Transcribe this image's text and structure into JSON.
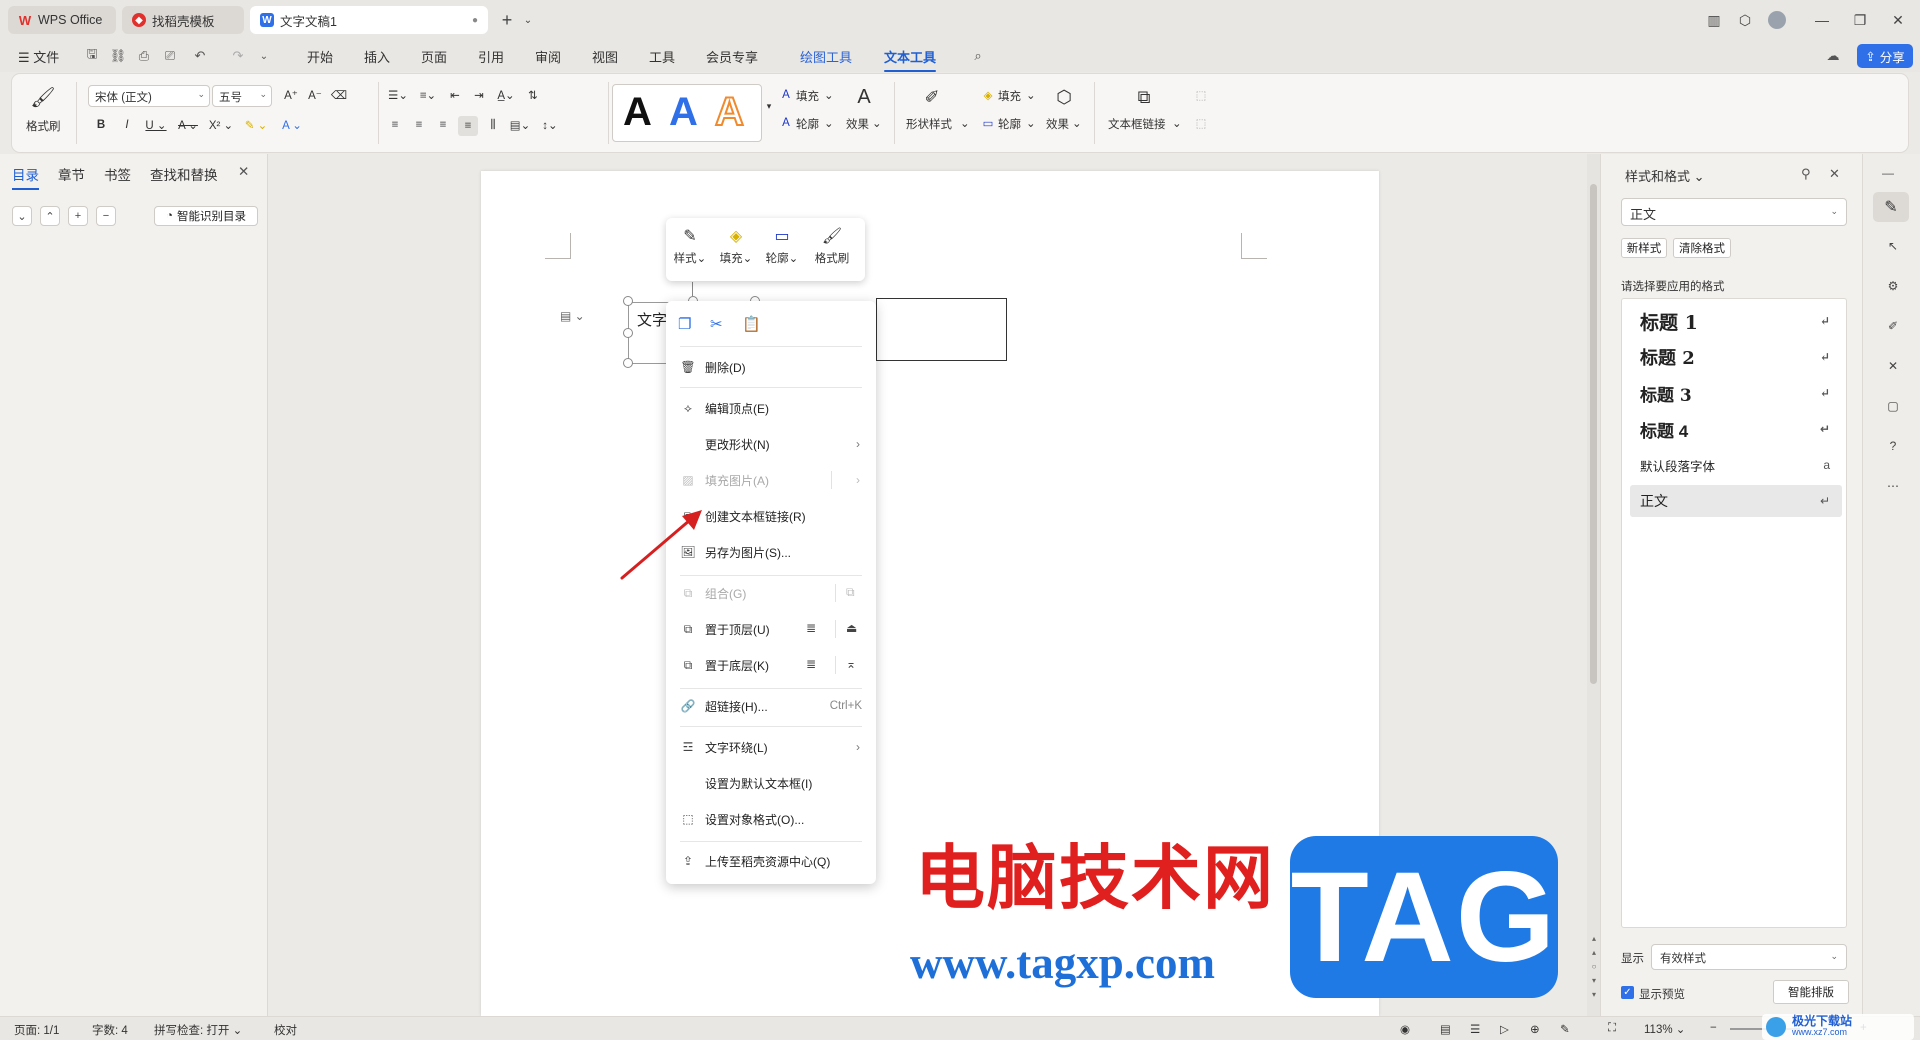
{
  "tabs": [
    {
      "label": "WPS Office",
      "icon": "wps-logo-icon"
    },
    {
      "label": "找稻壳模板",
      "icon": "docer-icon"
    },
    {
      "label": "文字文稿1",
      "icon": "writer-icon"
    }
  ],
  "menubar": {
    "file": "文件",
    "items": [
      "开始",
      "插入",
      "页面",
      "引用",
      "审阅",
      "视图",
      "工具",
      "会员专享"
    ],
    "context_tabs": [
      "绘图工具",
      "文本工具"
    ],
    "share": "分享"
  },
  "ribbon": {
    "format_painter": "格式刷",
    "font_name": "宋体 (正文)",
    "font_size": "五号",
    "fill": "填充",
    "outline": "轮廓",
    "effect": "效果",
    "shape_style": "形状样式",
    "fill2": "填充",
    "outline2": "轮廓",
    "effect2": "效果",
    "textbox_link": "文本框链接",
    "art_letters": [
      "A",
      "A",
      "A"
    ]
  },
  "leftpanel": {
    "tabs": [
      "目录",
      "章节",
      "书签",
      "查找和替换"
    ],
    "smart_toc": "智能识别目录"
  },
  "document": {
    "textbox_text": "文字"
  },
  "float_toolbar": {
    "items": [
      "样式",
      "填充",
      "轮廓",
      "格式刷"
    ]
  },
  "context_menu": {
    "delete": "删除(D)",
    "edit_points": "编辑顶点(E)",
    "change_shape": "更改形状(N)",
    "fill_picture": "填充图片(A)",
    "create_textbox_link": "创建文本框链接(R)",
    "save_as_picture": "另存为图片(S)...",
    "group": "组合(G)",
    "bring_to_front": "置于顶层(U)",
    "send_to_back": "置于底层(K)",
    "hyperlink": "超链接(H)...",
    "hyperlink_shortcut": "Ctrl+K",
    "text_wrap": "文字环绕(L)",
    "set_default_textbox": "设置为默认文本框(I)",
    "format_object": "设置对象格式(O)...",
    "upload": "上传至稻壳资源中心(Q)"
  },
  "rightpanel": {
    "title": "样式和格式",
    "current_style": "正文",
    "new_style": "新样式",
    "clear_format": "清除格式",
    "prompt": "请选择要应用的格式",
    "styles": [
      "标题 1",
      "标题 2",
      "标题 3",
      "标题 4",
      "默认段落字体",
      "正文"
    ],
    "display_label": "显示",
    "display_value": "有效样式",
    "show_preview": "显示预览",
    "smart_layout": "智能排版"
  },
  "statusbar": {
    "page": "页面: 1/1",
    "words": "字数: 4",
    "spell": "拼写检查: 打开",
    "proof": "校对",
    "zoom": "113%"
  },
  "watermark": {
    "cn": "电脑技术网",
    "url": "www.tagxp.com",
    "tag": "TAG",
    "corner": "极光下载站",
    "corner_url": "www.xz7.com"
  },
  "colors": {
    "accent": "#1f5fd3",
    "share": "#2f6fe8",
    "wps_red": "#e0312d",
    "art_blue": "#2f6fe8",
    "art_orange": "#f08a2c",
    "arrow_red": "#d62020"
  }
}
